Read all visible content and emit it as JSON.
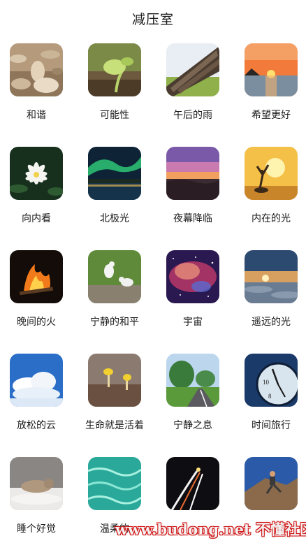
{
  "header": {
    "title": "减压室"
  },
  "items": [
    {
      "label": "和谐",
      "image": "stones-image"
    },
    {
      "label": "可能性",
      "image": "sprout-image"
    },
    {
      "label": "午后的雨",
      "image": "roof-tiles-image"
    },
    {
      "label": "希望更好",
      "image": "sunset-sea-image"
    },
    {
      "label": "向内看",
      "image": "lotus-image"
    },
    {
      "label": "北极光",
      "image": "aurora-image"
    },
    {
      "label": "夜幕降临",
      "image": "dusk-image"
    },
    {
      "label": "内在的光",
      "image": "woman-sunset-image"
    },
    {
      "label": "晚间的火",
      "image": "campfire-image"
    },
    {
      "label": "宁静的和平",
      "image": "doves-image"
    },
    {
      "label": "宇宙",
      "image": "nebula-image"
    },
    {
      "label": "遥远的光",
      "image": "clouds-sunrise-image"
    },
    {
      "label": "放松的云",
      "image": "sky-clouds-image"
    },
    {
      "label": "生命就是活着",
      "image": "mushroom-image"
    },
    {
      "label": "宁静之息",
      "image": "road-trees-image"
    },
    {
      "label": "时间旅行",
      "image": "clock-image"
    },
    {
      "label": "睡个好觉",
      "image": "sleeping-cat-image"
    },
    {
      "label": "温柔的",
      "image": "water-image"
    },
    {
      "label": "",
      "image": "night-road-image"
    },
    {
      "label": "",
      "image": "climber-image"
    }
  ],
  "watermark": {
    "text": "www.budong.net 不懂社区"
  }
}
